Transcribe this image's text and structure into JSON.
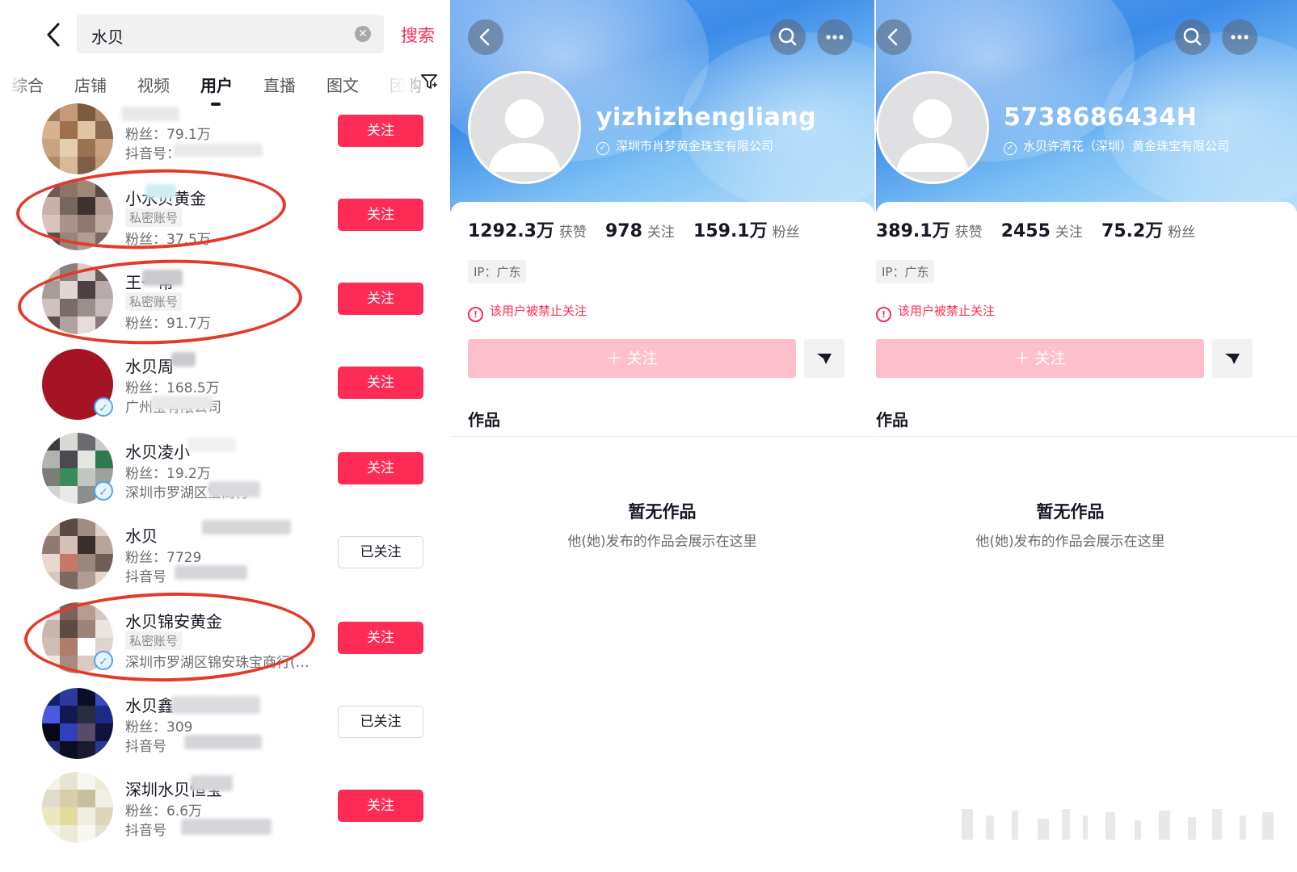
{
  "search": {
    "query": "水贝",
    "button": "搜索"
  },
  "tabs": [
    "综合",
    "店铺",
    "视频",
    "用户",
    "直播",
    "图文",
    "团购"
  ],
  "active_tab": "用户",
  "results": [
    {
      "name": "",
      "meta1": "粉丝：79.1万",
      "meta2": "抖音号：",
      "button": "关注",
      "followed": false
    },
    {
      "name": "小水贝黄金",
      "tag": "私密账号",
      "meta1": "粉丝：37.5万",
      "button": "关注",
      "followed": false,
      "circled": true
    },
    {
      "name": "王一常",
      "tag": "私密账号",
      "meta1": "粉丝：91.7万",
      "button": "关注",
      "followed": false,
      "circled": true
    },
    {
      "name": "水贝周",
      "meta1": "粉丝：168.5万",
      "meta2": "广州宝有限公司",
      "button": "关注",
      "followed": false,
      "verified": true
    },
    {
      "name": "水贝凌小",
      "meta1": "粉丝：19.2万",
      "meta2": "深圳市罗湖区宝商行",
      "button": "关注",
      "followed": false,
      "verified": true
    },
    {
      "name": "水贝",
      "meta1": "粉丝：7729",
      "meta2": "抖音号",
      "button": "已关注",
      "followed": true
    },
    {
      "name": "水贝锦安黄金",
      "tag": "私密账号",
      "meta2": "深圳市罗湖区锦安珠宝商行(…",
      "button": "关注",
      "followed": false,
      "verified": true,
      "circled": true
    },
    {
      "name": "水贝鑫",
      "meta1": "粉丝：309",
      "meta2": "抖音号",
      "button": "已关注",
      "followed": true
    },
    {
      "name": "深圳水贝恒宝",
      "meta1": "粉丝：6.6万",
      "meta2": "抖音号",
      "button": "关注",
      "followed": false
    }
  ],
  "profiles": [
    {
      "name": "yizhizhengliang",
      "cert": "深圳市肖梦黄金珠宝有限公司",
      "likes": "1292.3万",
      "likes_label": "获赞",
      "following": "978",
      "following_label": "关注",
      "fans": "159.1万",
      "fans_label": "粉丝",
      "ip": "IP：广东",
      "banned": "该用户被禁止关注",
      "follow_button": "＋ 关注",
      "works": "作品",
      "empty_title": "暂无作品",
      "empty_sub": "他(她)发布的作品会展示在这里"
    },
    {
      "name": "5738686434H",
      "cert": "水贝许清花（深圳）黄金珠宝有限公司",
      "likes": "389.1万",
      "likes_label": "获赞",
      "following": "2455",
      "following_label": "关注",
      "fans": "75.2万",
      "fans_label": "粉丝",
      "ip": "IP：广东",
      "banned": "该用户被禁止关注",
      "follow_button": "＋ 关注",
      "works": "作品",
      "empty_title": "暂无作品",
      "empty_sub": "他(她)发布的作品会展示在这里"
    }
  ],
  "colors": {
    "accent": "#fe2c55",
    "follow_disabled": "#fec0cc",
    "circle_annotation": "#e33a2a",
    "banner": "#3b8be8"
  },
  "icons": [
    "back-chevron-icon",
    "clear-icon",
    "filter-icon",
    "search-icon",
    "more-icon",
    "warning-icon",
    "dropdown-triangle-icon",
    "verified-icon",
    "default-avatar-icon"
  ]
}
